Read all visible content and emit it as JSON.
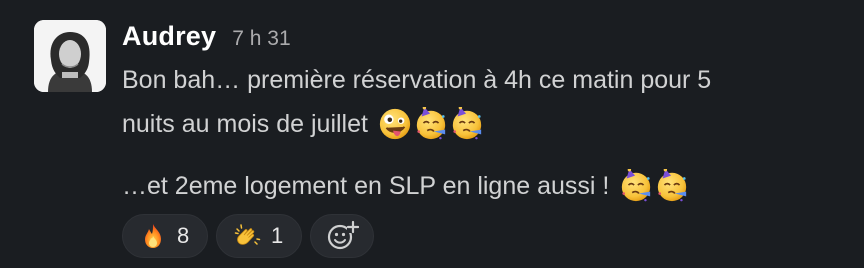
{
  "message": {
    "author": "Audrey",
    "time": "7 h 31",
    "line1": "Bon bah… première réservation à 4h ce matin pour 5",
    "line2": "nuits au mois de juillet",
    "line3": "…et 2eme logement en SLP en ligne aussi !",
    "line2_emojis": [
      "zany-face",
      "partying-face",
      "partying-face"
    ],
    "line3_emojis": [
      "partying-face",
      "partying-face"
    ]
  },
  "reactions": [
    {
      "emoji": "fire",
      "count": "8"
    },
    {
      "emoji": "clapping-hands",
      "count": "1"
    }
  ],
  "add_reaction": {
    "icon": "add-reaction-icon"
  }
}
